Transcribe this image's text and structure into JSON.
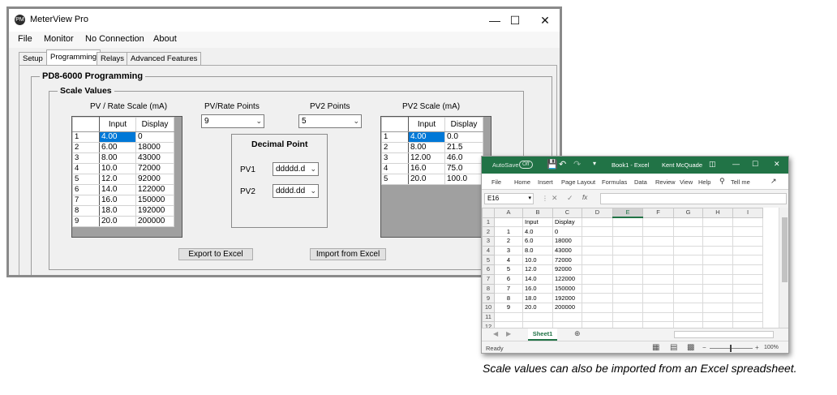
{
  "meterview": {
    "title": "MeterView Pro",
    "app_icon": "PM",
    "window_controls": {
      "minimize": "—",
      "maximize": "☐",
      "close": "✕"
    },
    "menu": [
      "File",
      "Monitor",
      "No Connection",
      "About"
    ],
    "tabs": [
      "Setup",
      "Programming",
      "Relays",
      "Advanced Features"
    ],
    "active_tab": "Programming",
    "page_title": "PD8-6000 Programming",
    "scale_values_title": "Scale Values",
    "pv_scale": {
      "label": "PV / Rate Scale (mA)",
      "headers": [
        "Input",
        "Display"
      ],
      "rows": [
        [
          "1",
          "4.00",
          "0"
        ],
        [
          "2",
          "6.00",
          "18000"
        ],
        [
          "3",
          "8.00",
          "43000"
        ],
        [
          "4",
          "10.0",
          "72000"
        ],
        [
          "5",
          "12.0",
          "92000"
        ],
        [
          "6",
          "14.0",
          "122000"
        ],
        [
          "7",
          "16.0",
          "150000"
        ],
        [
          "8",
          "18.0",
          "192000"
        ],
        [
          "9",
          "20.0",
          "200000"
        ]
      ]
    },
    "pv_rate_points": {
      "label": "PV/Rate Points",
      "value": "9"
    },
    "pv2_points": {
      "label": "PV2 Points",
      "value": "5"
    },
    "decimal_point": {
      "title": "Decimal Point",
      "pv1_label": "PV1",
      "pv1_value": "ddddd.d",
      "pv2_label": "PV2",
      "pv2_value": "dddd.dd"
    },
    "pv2_scale": {
      "label": "PV2 Scale (mA)",
      "headers": [
        "Input",
        "Display"
      ],
      "rows": [
        [
          "1",
          "4.00",
          "0.0"
        ],
        [
          "2",
          "8.00",
          "21.5"
        ],
        [
          "3",
          "12.00",
          "46.0"
        ],
        [
          "4",
          "16.0",
          "75.0"
        ],
        [
          "5",
          "20.0",
          "100.0"
        ]
      ]
    },
    "export_button": "Export to Excel",
    "import_button": "Import from Excel"
  },
  "excel": {
    "autosave_label": "AutoSave",
    "autosave_state": "Off",
    "doc_title": "Book1 - Excel",
    "user": "Kent McQuade",
    "ribbon_tabs": [
      "File",
      "Home",
      "Insert",
      "Page Layout",
      "Formulas",
      "Data",
      "Review",
      "View",
      "Help"
    ],
    "tell_me": "Tell me",
    "name_box": "E16",
    "fx": "fx",
    "columns": [
      "A",
      "B",
      "C",
      "D",
      "E",
      "F",
      "G",
      "H",
      "I"
    ],
    "selected_column": "E",
    "rows": [
      [
        "1",
        "",
        "Input",
        "Display"
      ],
      [
        "2",
        "1",
        "4.0",
        "0"
      ],
      [
        "3",
        "2",
        "6.0",
        "18000"
      ],
      [
        "4",
        "3",
        "8.0",
        "43000"
      ],
      [
        "5",
        "4",
        "10.0",
        "72000"
      ],
      [
        "6",
        "5",
        "12.0",
        "92000"
      ],
      [
        "7",
        "6",
        "14.0",
        "122000"
      ],
      [
        "8",
        "7",
        "16.0",
        "150000"
      ],
      [
        "9",
        "8",
        "18.0",
        "192000"
      ],
      [
        "10",
        "9",
        "20.0",
        "200000"
      ],
      [
        "11",
        "",
        "",
        ""
      ],
      [
        "12",
        "",
        "",
        ""
      ]
    ],
    "sheet_tab": "Sheet1",
    "status": "Ready",
    "zoom": "100%",
    "accent_color": "#217346"
  },
  "caption": "Scale values can also be imported from an Excel spreadsheet."
}
